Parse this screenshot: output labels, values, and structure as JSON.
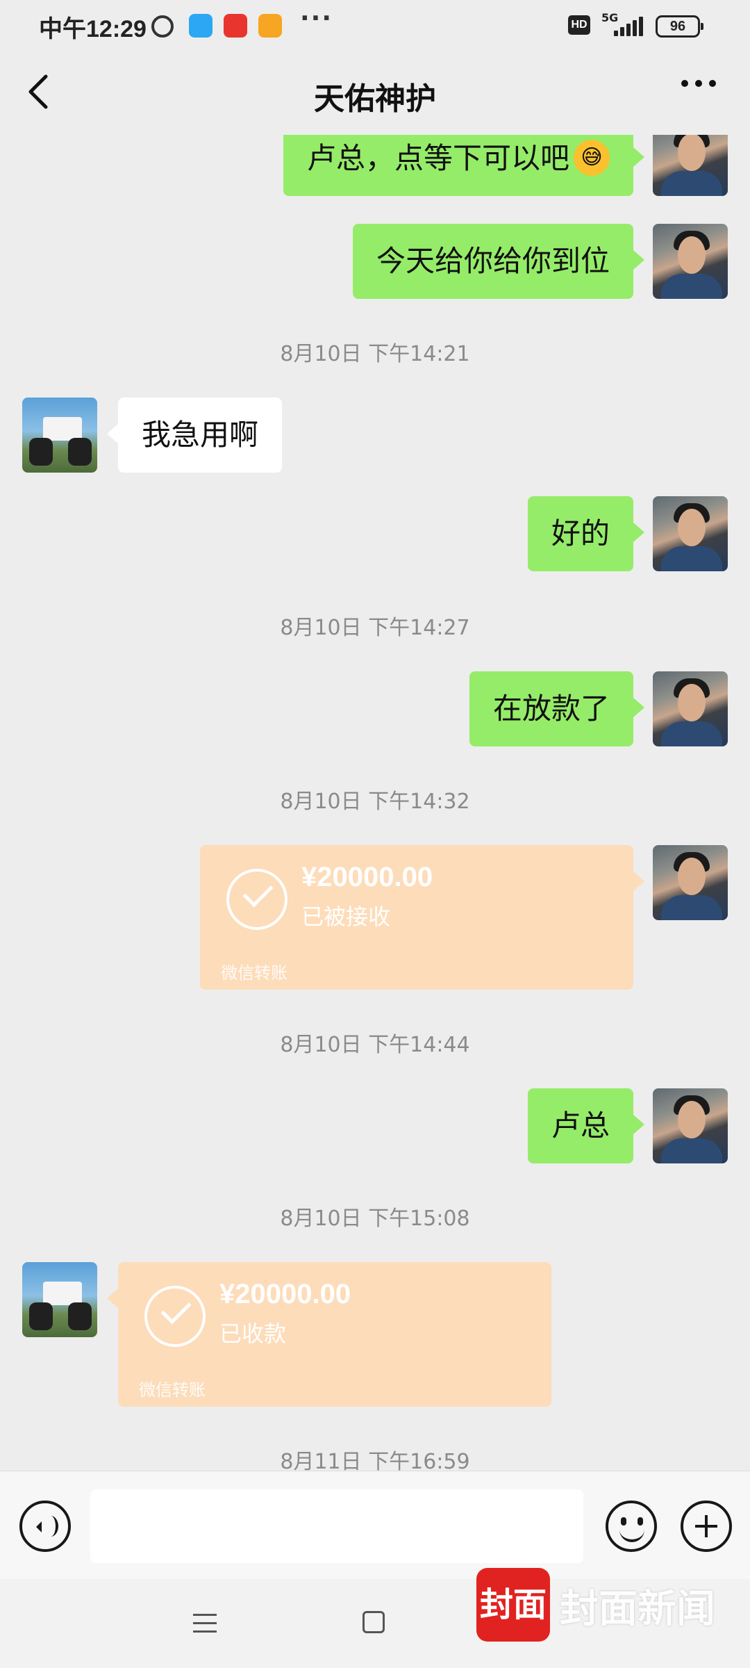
{
  "status_bar": {
    "time": "中午12:29",
    "network": "5G",
    "battery": "96",
    "hd": "HD",
    "more_dots": "···"
  },
  "header": {
    "title": "天佑神护",
    "back_icon": "chevron-left-icon",
    "more_icon": "more-dots-icon"
  },
  "messages": {
    "m1": {
      "sender": "me",
      "text": "卢总，点等下可以吧"
    },
    "m2": {
      "sender": "me",
      "text": "今天给你给你到位"
    },
    "t1": "8月10日 下午14:21",
    "m3": {
      "sender": "them",
      "text": "我急用啊"
    },
    "m4": {
      "sender": "me",
      "text": "好的"
    },
    "t2": "8月10日 下午14:27",
    "m5": {
      "sender": "me",
      "text": "在放款了"
    },
    "t3": "8月10日 下午14:32",
    "tr1": {
      "sender": "me",
      "amount": "¥20000.00",
      "status": "已被接收",
      "label": "微信转账"
    },
    "t4": "8月10日 下午14:44",
    "m6": {
      "sender": "me",
      "text": "卢总"
    },
    "t5": "8月10日 下午15:08",
    "tr2": {
      "sender": "them",
      "amount": "¥20000.00",
      "status": "已收款",
      "label": "微信转账"
    },
    "t6": "8月11日 下午16:59"
  },
  "input_bar": {
    "voice_icon": "voice-icon",
    "emoji_icon": "emoji-icon",
    "plus_icon": "plus-icon"
  },
  "watermark": {
    "logo": "封面",
    "text": "封面新闻"
  },
  "colors": {
    "my_bubble": "#95ec69",
    "their_bubble": "#ffffff",
    "transfer": "#fddcba",
    "background": "#ededed"
  }
}
